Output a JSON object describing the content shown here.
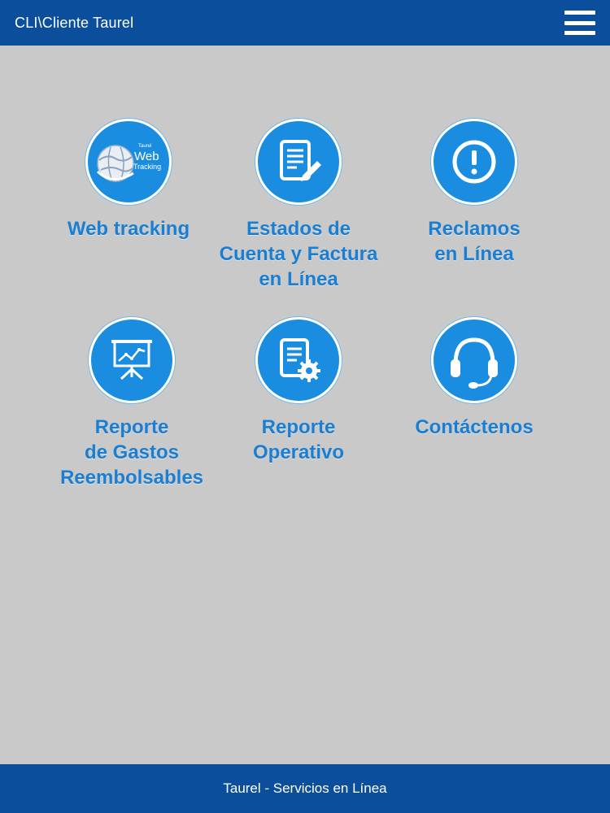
{
  "header": {
    "title": "CLI\\Cliente Taurel",
    "menu_icon": "hamburger-menu-icon"
  },
  "tiles": [
    {
      "id": "web-tracking",
      "label_lines": [
        "Web tracking"
      ],
      "icon": "web-tracking-globe-icon",
      "icon_text": {
        "brand": "Taurel",
        "line1": "Web",
        "line2": "Tracking"
      }
    },
    {
      "id": "estados-cuenta",
      "label_lines": [
        "Estados de",
        "Cuenta y Factura",
        "en Línea"
      ],
      "icon": "document-edit-icon"
    },
    {
      "id": "reclamos",
      "label_lines": [
        "Reclamos",
        "en Línea"
      ],
      "icon": "exclamation-icon"
    },
    {
      "id": "gastos",
      "label_lines": [
        "Reporte",
        "de Gastos",
        "Reembolsables"
      ],
      "icon": "presentation-chart-icon"
    },
    {
      "id": "operativo",
      "label_lines": [
        "Reporte",
        "Operativo"
      ],
      "icon": "document-gear-icon"
    },
    {
      "id": "contactenos",
      "label_lines": [
        "Contáctenos"
      ],
      "icon": "headset-icon"
    }
  ],
  "footer": {
    "text": "Taurel - Servicios en Línea"
  },
  "colors": {
    "bar": "#0b4f9c",
    "accent": "#1a8de0",
    "label": "#1a7fd2",
    "background": "#c9c9c9"
  }
}
